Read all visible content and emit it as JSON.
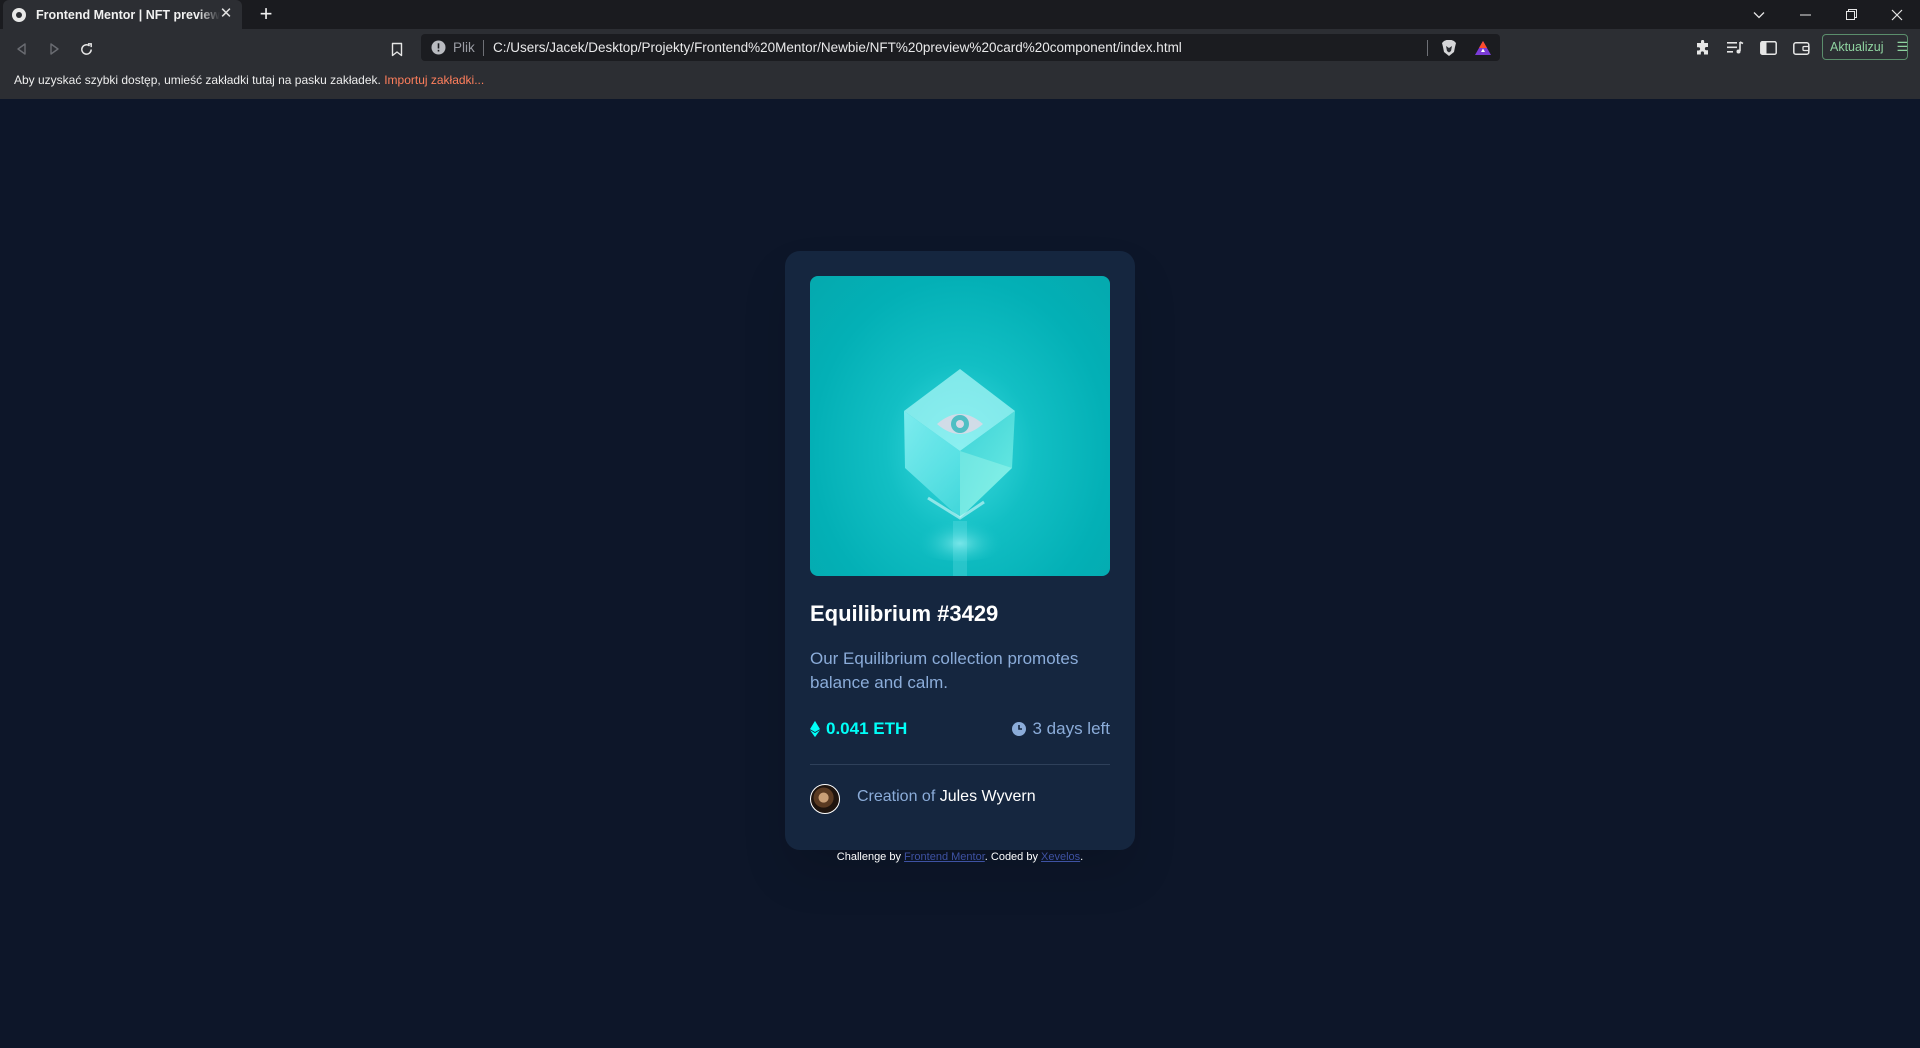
{
  "browser": {
    "tab_title": "Frontend Mentor | NFT preview card component",
    "new_tab_label": "+",
    "address_scheme_label": "Plik",
    "url": "C:/Users/Jacek/Desktop/Projekty/Frontend%20Mentor/Newbie/NFT%20preview%20card%20component/index.html",
    "update_button_label": "Aktualizuj",
    "bookmark_bar_text": "Aby uzyskać szybki dostęp, umieść zakładki tutaj na pasku zakładek.",
    "bookmark_bar_import_link": "Importuj zakładki..."
  },
  "card": {
    "image_icon": "eye-icon",
    "title": "Equilibrium #3429",
    "description": "Our Equilibrium collection promotes balance and calm.",
    "price": "0.041 ETH",
    "time_left": "3 days left",
    "creator_prefix": "Creation of",
    "creator_name": "Jules Wyvern"
  },
  "footer": {
    "challenge_by": "Challenge by",
    "challenge_link": "Frontend Mentor",
    "coded_by": ". Coded by",
    "coder_link": "Xevelos",
    "end": "."
  },
  "colors": {
    "page_bg": "#0d1629",
    "card_bg": "#15263f",
    "accent_cyan": "#00fff8",
    "soft_blue": "#8bacd9",
    "white": "#ffffff"
  }
}
